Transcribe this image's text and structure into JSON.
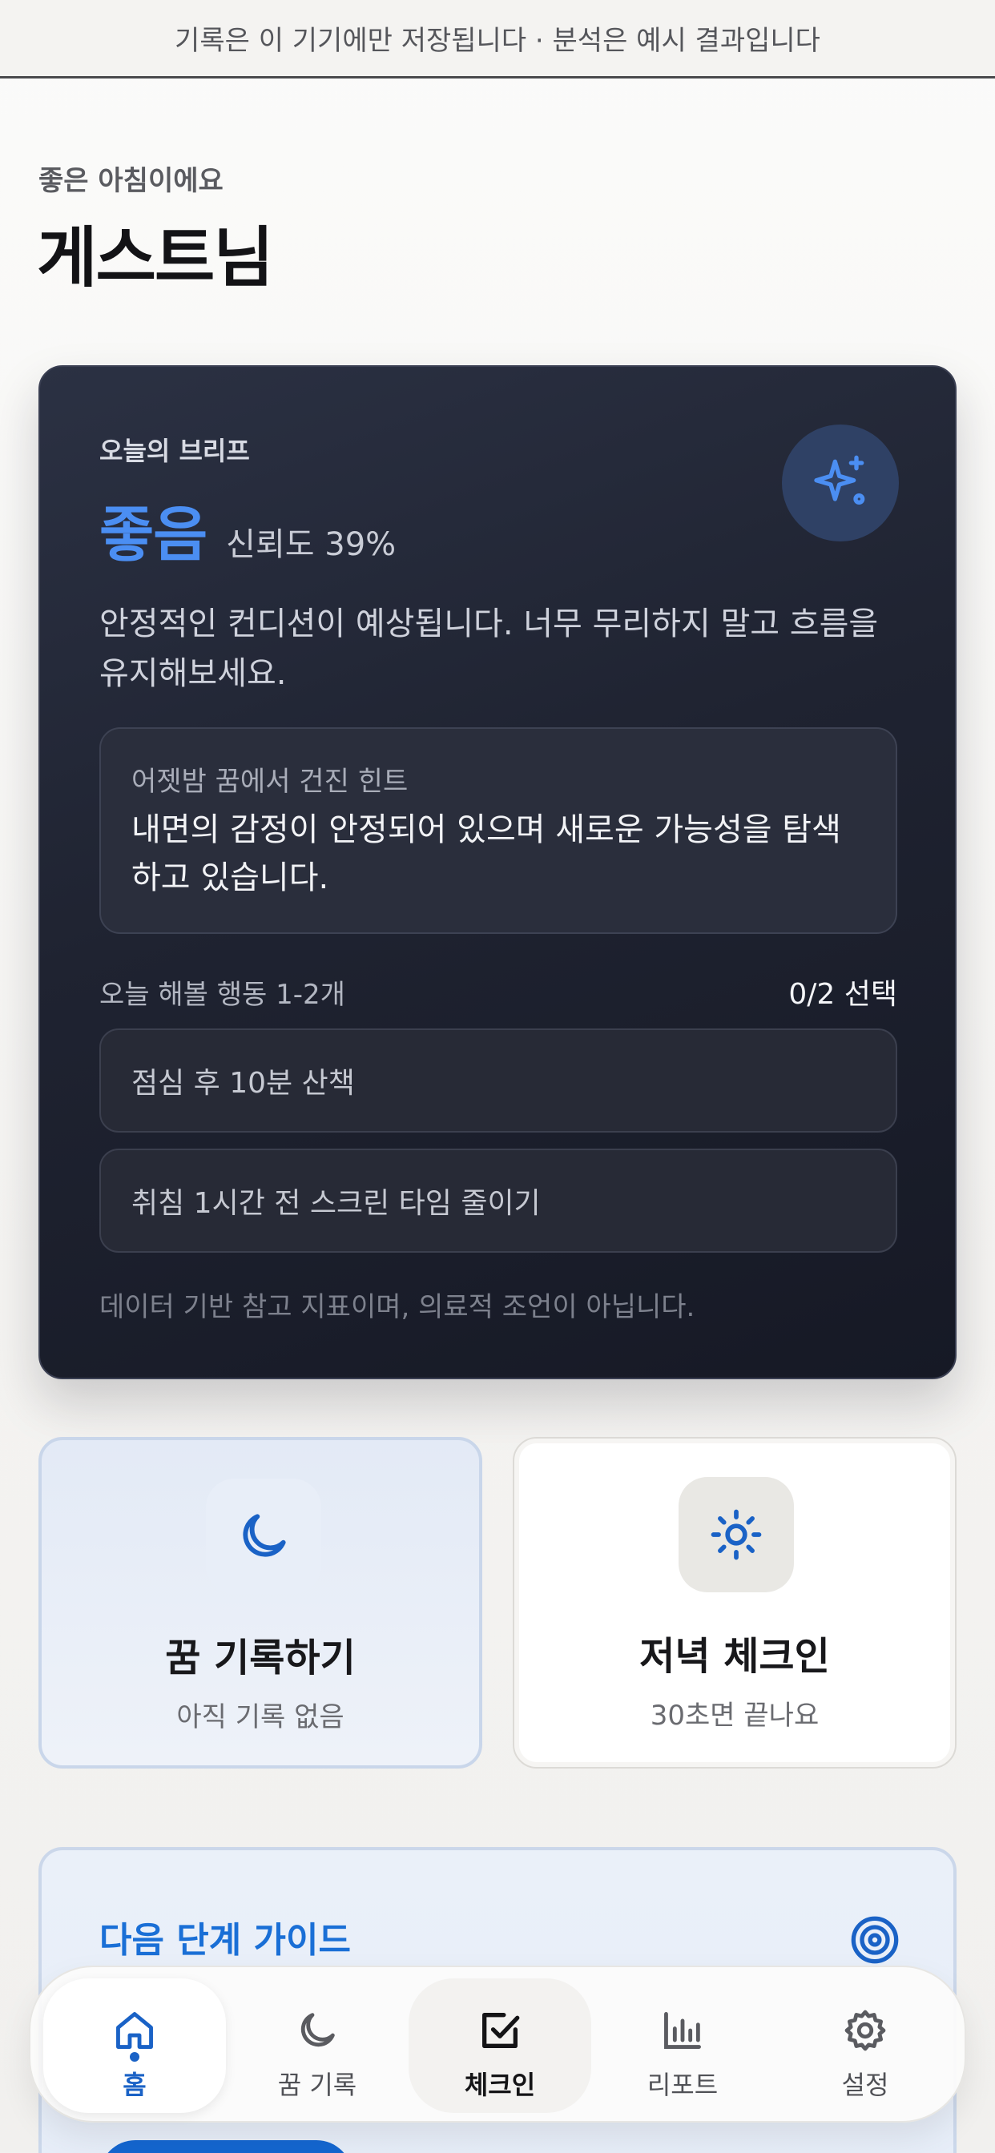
{
  "banner": {
    "text": "기록은 이 기기에만 저장됩니다 · 분석은 예시 결과입니다"
  },
  "header": {
    "greeting": "좋은 아침이에요",
    "username": "게스트님"
  },
  "brief": {
    "label": "오늘의 브리프",
    "status": "좋음",
    "confidence": "신뢰도 39%",
    "summary": "안정적인 컨디션이 예상됩니다. 너무 무리하지 말고 흐름을 유지해보세요.",
    "hint_label": "어젯밤 꿈에서 건진 힌트",
    "hint_text": "내면의 감정이 안정되어 있으며 새로운 가능성을 탐색하고 있습니다.",
    "actions_heading": "오늘 해볼 행동 1-2개",
    "actions_count": "0/2 선택",
    "actions": [
      "점심 후 10분 산책",
      "취침 1시간 전 스크린 타임 줄이기"
    ],
    "disclaimer": "데이터 기반 참고 지표이며, 의료적 조언이 아닙니다.",
    "accent_color": "#4b8ef2"
  },
  "tiles": {
    "dream": {
      "title": "꿈 기록하기",
      "subtitle": "아직 기록 없음",
      "icon": "moon-icon"
    },
    "checkin": {
      "title": "저녁 체크인",
      "subtitle": "30초면 끝나요",
      "icon": "sun-icon"
    }
  },
  "guide": {
    "title": "다음 단계 가이드",
    "icon": "target-icon"
  },
  "nav": {
    "items": [
      {
        "label": "홈",
        "icon": "home-icon",
        "active": true
      },
      {
        "label": "꿈 기록",
        "icon": "moon-icon"
      },
      {
        "label": "체크인",
        "icon": "checkbox-icon"
      },
      {
        "label": "리포트",
        "icon": "bar-chart-icon"
      },
      {
        "label": "설정",
        "icon": "gear-icon"
      }
    ],
    "active_color": "#1a62c6"
  }
}
